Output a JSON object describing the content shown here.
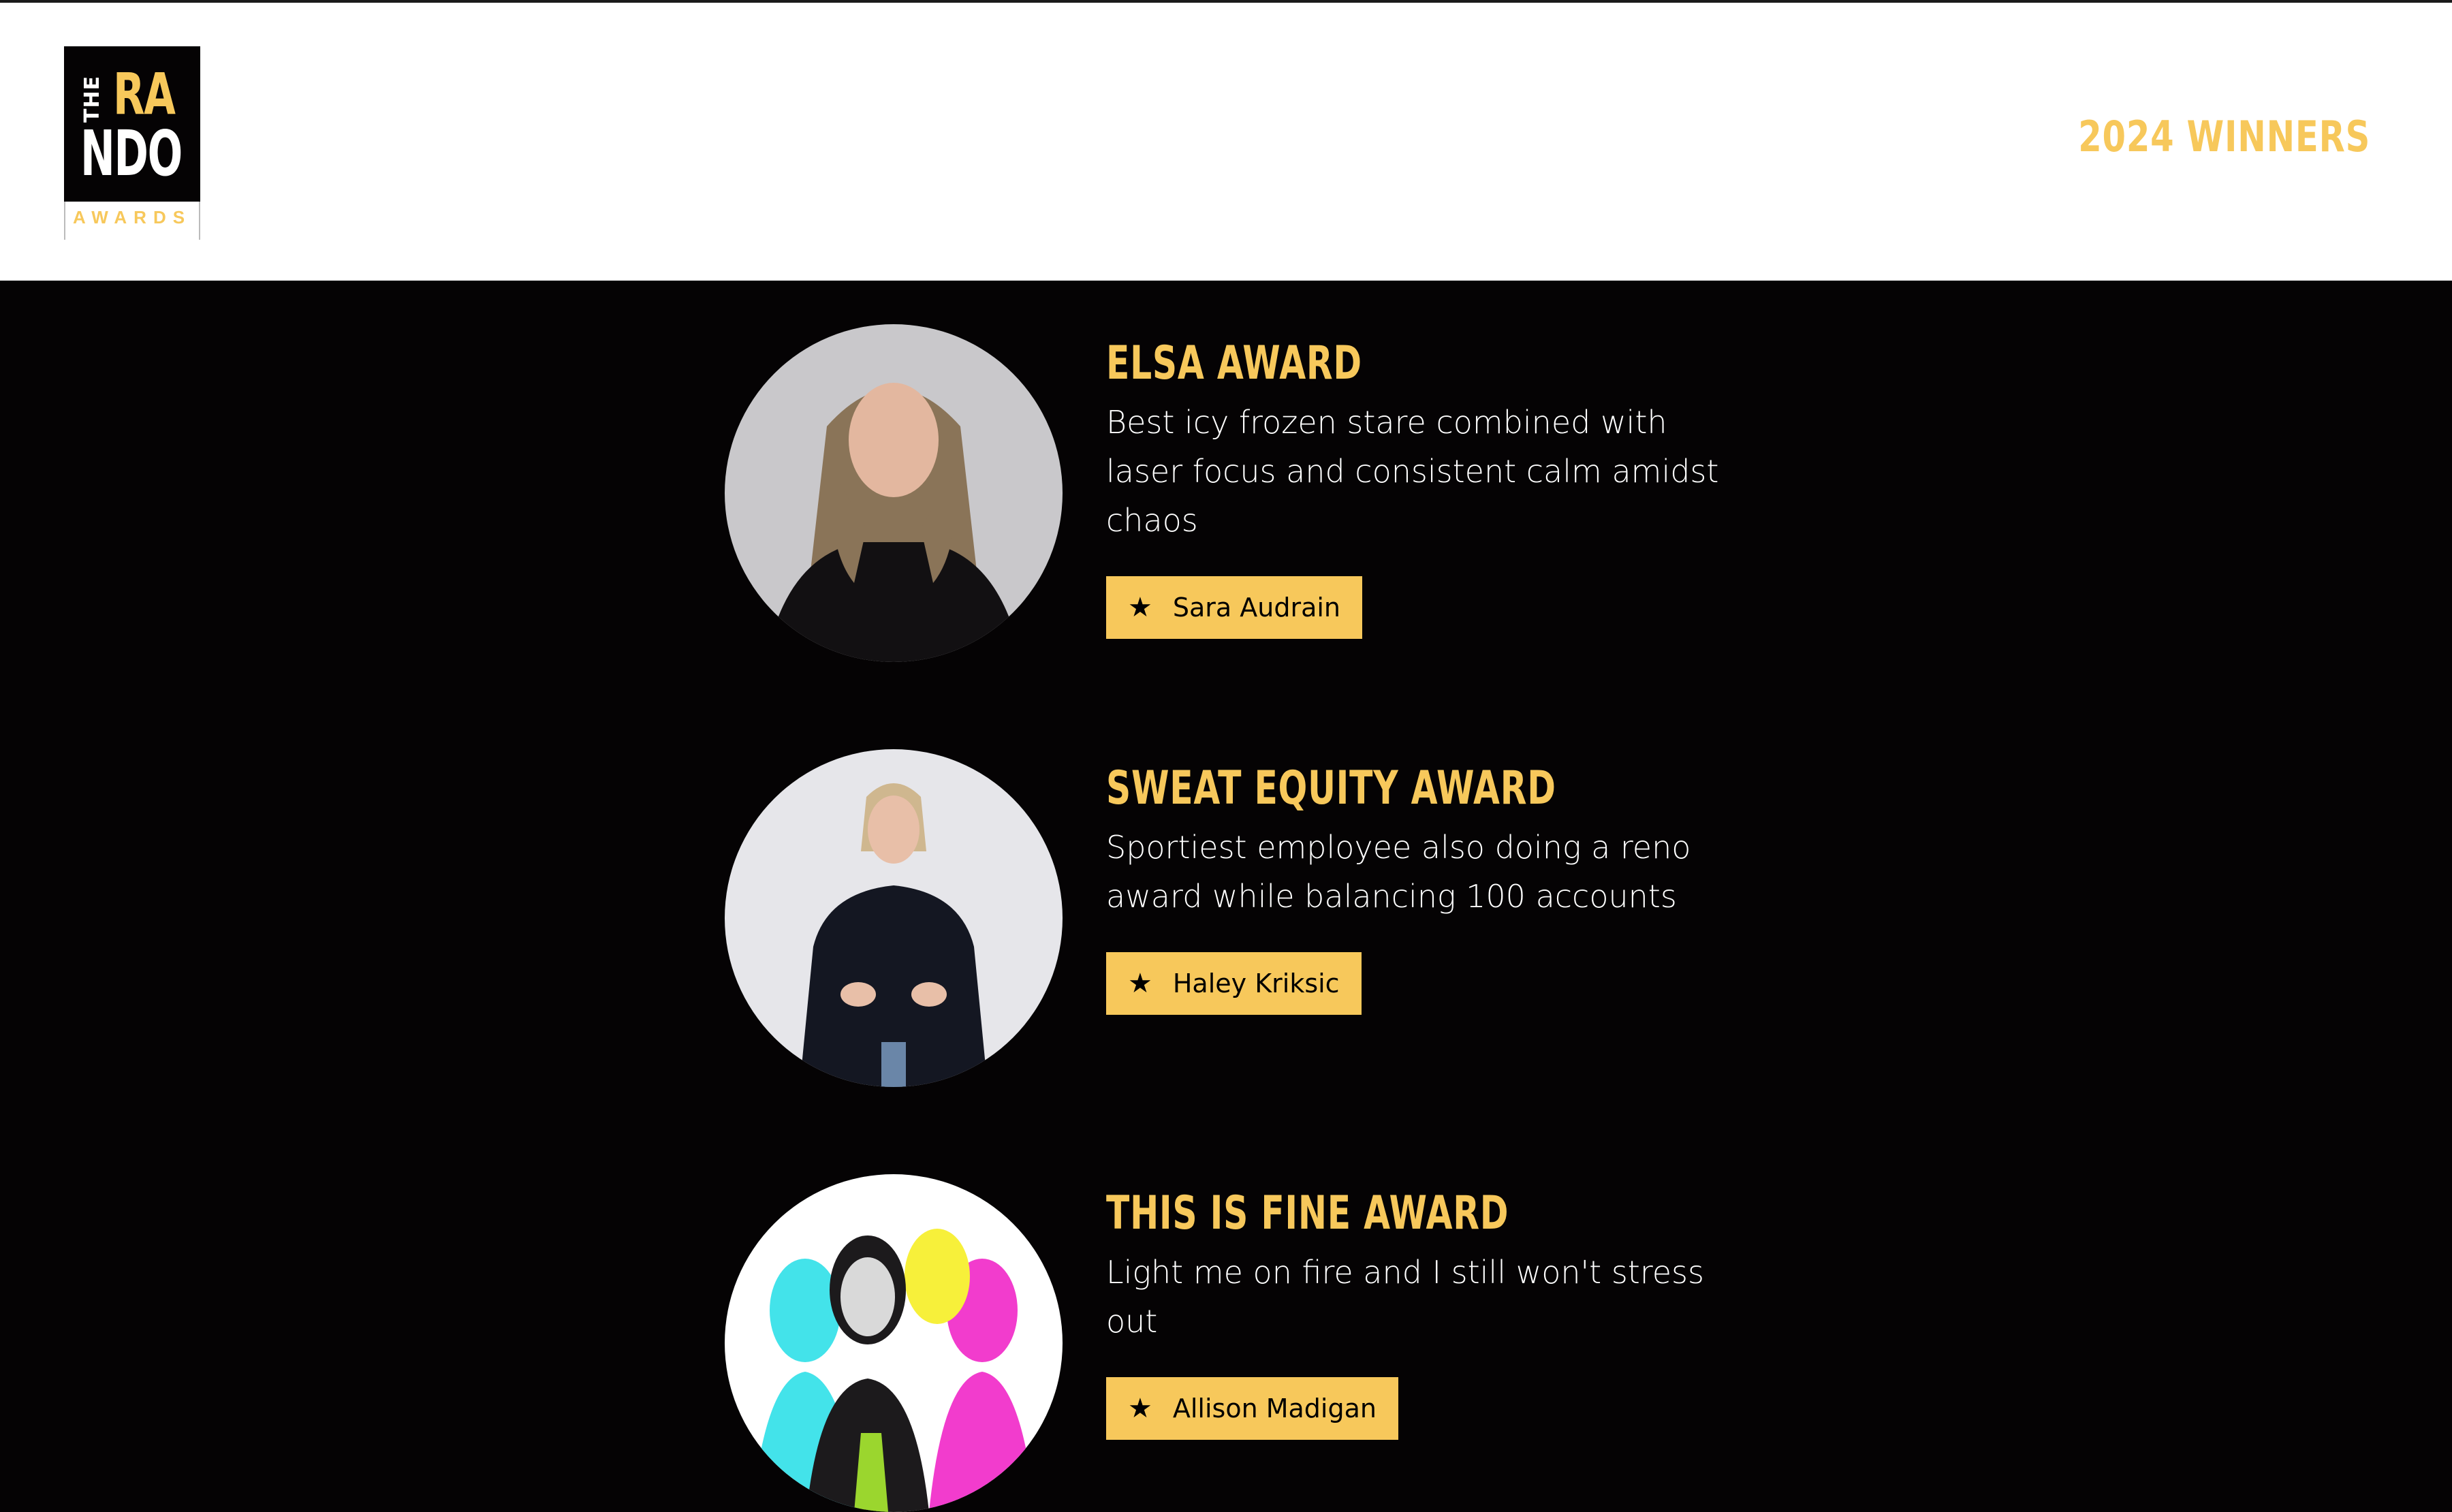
{
  "logo": {
    "the": "THE",
    "ra": "RA",
    "ndo": "NDO",
    "awards": "AWARDS"
  },
  "header": {
    "link_label": "2024 WINNERS"
  },
  "colors": {
    "accent": "#f7c85b",
    "background": "#050304",
    "header_bg": "#ffffff"
  },
  "awards": [
    {
      "title": "ELSA AWARD",
      "description": "Best icy frozen stare combined with laser focus and consistent calm amidst chaos",
      "winner": "Sara Audrain",
      "icon": "star-icon"
    },
    {
      "title": "SWEAT EQUITY AWARD",
      "description": "Sportiest employee also doing a reno award while balancing 100 accounts",
      "winner": "Haley Kriksic",
      "icon": "star-icon"
    },
    {
      "title": "THIS IS FINE AWARD",
      "description": "Light me on fire and I still won't stress out",
      "winner": "Allison Madigan",
      "icon": "star-icon"
    }
  ]
}
